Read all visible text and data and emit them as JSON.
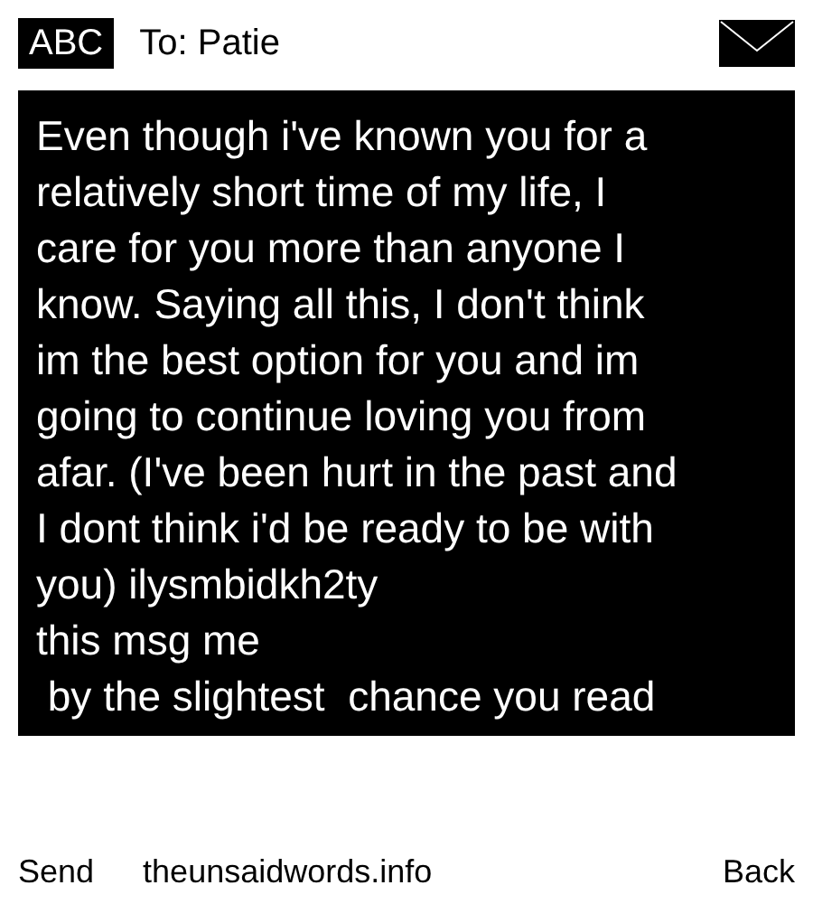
{
  "header": {
    "mode_badge": "ABC",
    "recipient": "To: Patie"
  },
  "message": {
    "lines": [
      "Even though i've known you for a",
      "relatively short time of my life, I",
      "care for you more than anyone I",
      "know. Saying all this, I don't think",
      "im the best option for you and im",
      "going to continue loving you from",
      "afar. (I've been hurt in the past and",
      "I dont think i'd be ready to be with",
      "you) ilysmbidkh2ty",
      "this msg me",
      " by the slightest  chance you read"
    ]
  },
  "footer": {
    "left": "Send",
    "center": "theunsaidwords.info",
    "right": "Back"
  }
}
